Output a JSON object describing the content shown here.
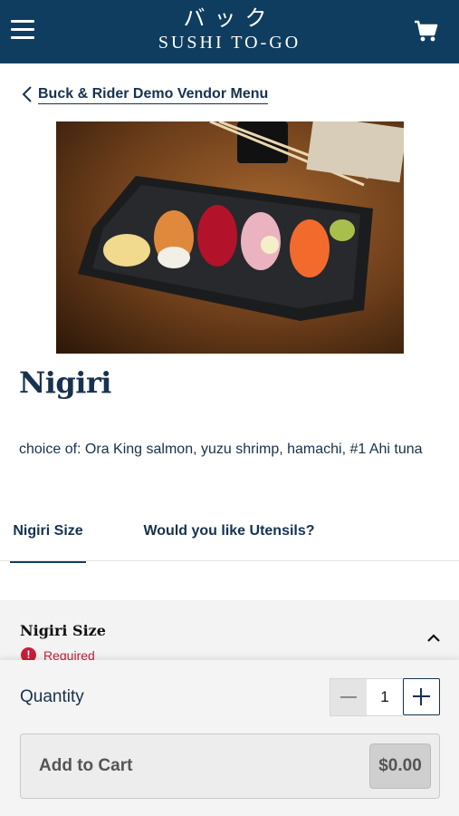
{
  "header": {
    "logo_jp": "バック",
    "logo_en": "SUSHI TO-GO",
    "menu_icon": "hamburger-menu-icon",
    "cart_icon": "shopping-cart-icon",
    "background_color": "#0f3d5f"
  },
  "nav": {
    "back_label": "Buck & Rider Demo Vendor Menu",
    "back_icon": "chevron-left-icon"
  },
  "product": {
    "image_alt": "Nigiri sushi on a black tray",
    "title": "Nigiri",
    "description": "choice of: Ora King salmon, yuzu shrimp, hamachi, #1 Ahi tuna"
  },
  "tabs": [
    {
      "label": "Nigiri Size",
      "active": true
    },
    {
      "label": "Would you like Utensils?",
      "active": false
    }
  ],
  "option_section": {
    "title": "Nigiri Size",
    "required_label": "Required",
    "required_icon": "alert-circle-icon",
    "toggle_icon": "chevron-up-icon"
  },
  "order": {
    "quantity_label": "Quantity",
    "quantity_value": "1",
    "add_to_cart_label": "Add to Cart",
    "price": "$0.00"
  },
  "colors": {
    "brand": "#0f3d5f",
    "text": "#16324f",
    "required": "#c81e3a"
  }
}
